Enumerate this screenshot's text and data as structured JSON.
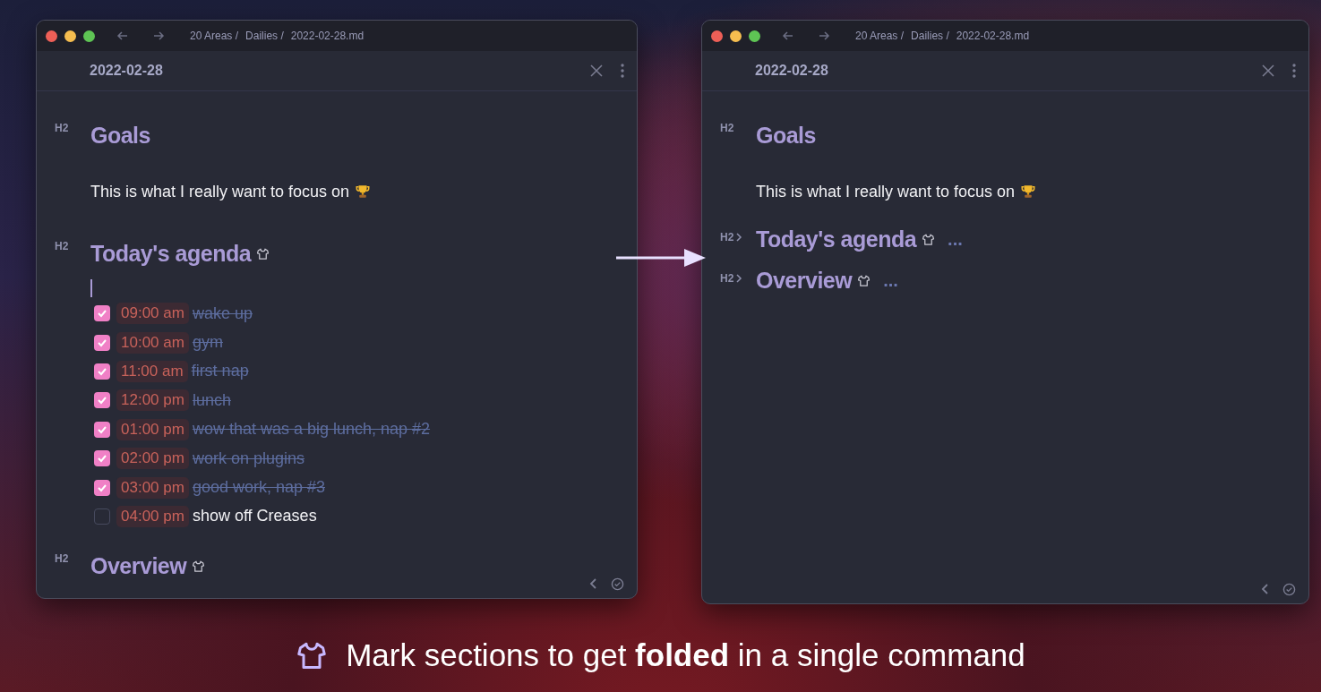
{
  "windows": [
    {
      "breadcrumb": [
        "20 Areas /",
        "Dailies /",
        "2022-02-28.md"
      ],
      "title": "2022-02-28",
      "blocks": [
        {
          "kind": "heading",
          "level": "H2",
          "text": "Goals",
          "marked": false,
          "folded": false
        },
        {
          "kind": "paragraph",
          "text": "This is what I really want to focus on",
          "trophy": true
        },
        {
          "kind": "heading",
          "level": "H2",
          "text": "Today's agenda",
          "marked": true,
          "folded": false
        },
        {
          "kind": "cursor"
        },
        {
          "kind": "task",
          "time": "09:00 am",
          "text": "wake up",
          "checked": true
        },
        {
          "kind": "task",
          "time": "10:00 am",
          "text": "gym",
          "checked": true
        },
        {
          "kind": "task",
          "time": "11:00 am",
          "text": "first nap",
          "checked": true
        },
        {
          "kind": "task",
          "time": "12:00 pm",
          "text": "lunch",
          "checked": true
        },
        {
          "kind": "task",
          "time": "01:00 pm",
          "text": "wow that was a big lunch, nap #2",
          "checked": true
        },
        {
          "kind": "task",
          "time": "02:00 pm",
          "text": "work on plugins",
          "checked": true
        },
        {
          "kind": "task",
          "time": "03:00 pm",
          "text": "good work, nap #3",
          "checked": true
        },
        {
          "kind": "task",
          "time": "04:00 pm",
          "text": "show off Creases",
          "checked": false
        },
        {
          "kind": "heading",
          "level": "H2",
          "text": "Overview",
          "marked": true,
          "folded": false
        }
      ]
    },
    {
      "breadcrumb": [
        "20 Areas /",
        "Dailies /",
        "2022-02-28.md"
      ],
      "title": "2022-02-28",
      "blocks": [
        {
          "kind": "heading",
          "level": "H2",
          "text": "Goals",
          "marked": false,
          "folded": false
        },
        {
          "kind": "paragraph",
          "text": "This is what I really want to focus on",
          "trophy": true
        },
        {
          "kind": "heading",
          "level": "H2",
          "text": "Today's agenda",
          "marked": true,
          "folded": true,
          "ellipsis": "..."
        },
        {
          "kind": "heading",
          "level": "H2",
          "text": "Overview",
          "marked": true,
          "folded": true,
          "ellipsis": "..."
        }
      ]
    }
  ],
  "caption": "Mark sections to get **folded** in a single command"
}
